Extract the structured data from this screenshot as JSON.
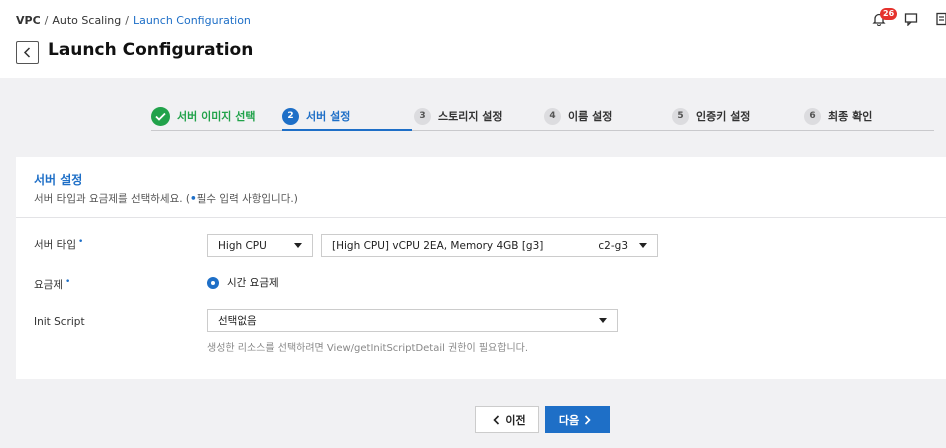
{
  "breadcrumb": {
    "items": [
      "VPC",
      "Auto Scaling"
    ],
    "current": "Launch Configuration"
  },
  "header": {
    "title": "Launch Configuration",
    "notification_count": "26"
  },
  "stepper": {
    "steps": [
      {
        "num": "1",
        "label": "서버 이미지 선택",
        "state": "done"
      },
      {
        "num": "2",
        "label": "서버 설정",
        "state": "active"
      },
      {
        "num": "3",
        "label": "스토리지 설정",
        "state": "pending"
      },
      {
        "num": "4",
        "label": "이름 설정",
        "state": "pending"
      },
      {
        "num": "5",
        "label": "인증키 설정",
        "state": "pending"
      },
      {
        "num": "6",
        "label": "최종 확인",
        "state": "pending"
      }
    ]
  },
  "section": {
    "title": "서버 설정",
    "desc_prefix": "서버 타입과 요금제를 선택하세요. (",
    "desc_dot": "•",
    "desc_suffix": "필수 입력 사항입니다.)"
  },
  "form": {
    "server_type": {
      "label": "서버 타입",
      "required_mark": "•",
      "type_value": "High CPU",
      "spec_value": "[High CPU] vCPU 2EA, Memory 4GB [g3]",
      "spec_code": "c2-g3"
    },
    "pricing": {
      "label": "요금제",
      "required_mark": "•",
      "option": "시간 요금제"
    },
    "init_script": {
      "label": "Init Script",
      "value": "선택없음",
      "hint": "생성한 리소스를 선택하려면 View/getInitScriptDetail 권한이 필요합니다."
    }
  },
  "footer": {
    "prev_label": "이전",
    "next_label": "다음"
  },
  "colors": {
    "accent": "#1e6fc7",
    "success": "#21a24a",
    "badge": "#e5322d",
    "background": "#f1f1f3"
  }
}
